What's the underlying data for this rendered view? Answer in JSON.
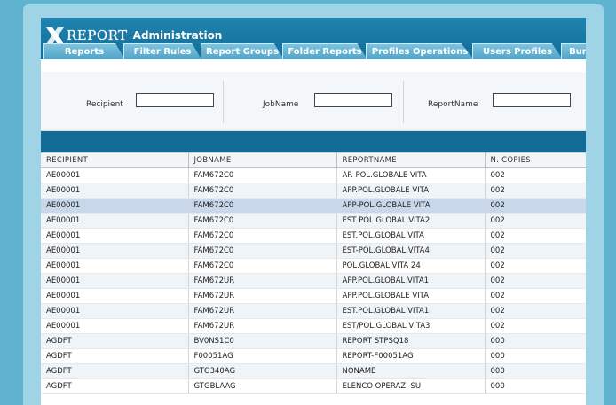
{
  "header": {
    "brand": "REPORT",
    "title": "Administration"
  },
  "tabs": [
    {
      "label": "Reports"
    },
    {
      "label": "Filter Rules"
    },
    {
      "label": "Report Groups"
    },
    {
      "label": "Folder Reports"
    },
    {
      "label": "Profiles Operations"
    },
    {
      "label": "Users Profiles"
    },
    {
      "label": "Bun"
    }
  ],
  "filters": {
    "recipient_label": "Recipient",
    "recipient_value": "",
    "jobname_label": "JobName",
    "jobname_value": "",
    "reportname_label": "ReportName",
    "reportname_value": ""
  },
  "table": {
    "columns": [
      "RECIPIENT",
      "JOBNAME",
      "REPORTNAME",
      "N. COPIES"
    ],
    "rows": [
      [
        "AE00001",
        "FAM672C0",
        "AP. POL.GLOBALE VITA",
        "002"
      ],
      [
        "AE00001",
        "FAM672C0",
        "APP.POL.GLOBALE VITA",
        "002"
      ],
      [
        "AE00001",
        "FAM672C0",
        "APP-POL.GLOBALE VITA",
        "002"
      ],
      [
        "AE00001",
        "FAM672C0",
        "EST POL.GLOBAL VITA2",
        "002"
      ],
      [
        "AE00001",
        "FAM672C0",
        "EST.POL.GLOBAL VITA",
        "002"
      ],
      [
        "AE00001",
        "FAM672C0",
        "EST-POL.GLOBAL VITA4",
        "002"
      ],
      [
        "AE00001",
        "FAM672C0",
        "POL.GLOBAL VITA 24",
        "002"
      ],
      [
        "AE00001",
        "FAM672UR",
        "APP.POL.GLOBAL VITA1",
        "002"
      ],
      [
        "AE00001",
        "FAM672UR",
        "APP.POL.GLOBALE VITA",
        "002"
      ],
      [
        "AE00001",
        "FAM672UR",
        "EST.POL.GLOBAL VITA1",
        "002"
      ],
      [
        "AE00001",
        "FAM672UR",
        "EST/POL.GLOBAL VITA3",
        "002"
      ],
      [
        "AGDFT",
        "BV0NS1C0",
        "REPORT STPSQ18",
        "000"
      ],
      [
        "AGDFT",
        "F00051AG",
        "REPORT-F00051AG",
        "000"
      ],
      [
        "AGDFT",
        "GTG340AG",
        "NONAME",
        "000"
      ],
      [
        "AGDFT",
        "GTGBLAAG",
        "ELENCO OPERAZ. SU",
        "000"
      ]
    ],
    "selected_row": 2
  },
  "colors": {
    "header": "#136c96",
    "tab": "#5aaed1",
    "selected_row": "#c8d8ea",
    "background": "#5fb3cf"
  }
}
